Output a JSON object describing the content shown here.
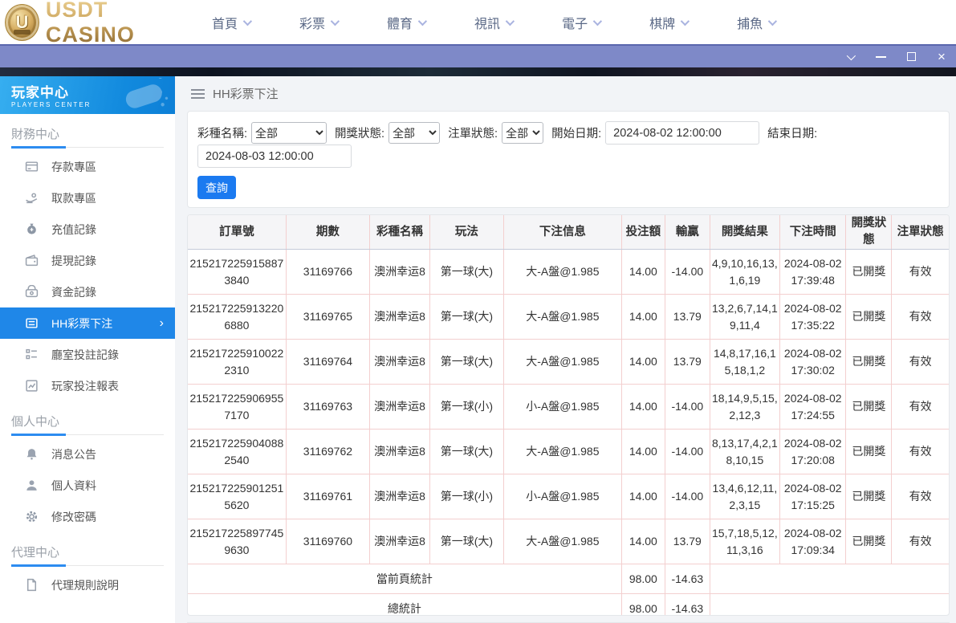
{
  "topnav": {
    "logo_text": "USDT CASINO",
    "logo_symbol": "U",
    "items": [
      {
        "label": "首頁"
      },
      {
        "label": "彩票"
      },
      {
        "label": "體育"
      },
      {
        "label": "視訊"
      },
      {
        "label": "電子"
      },
      {
        "label": "棋牌"
      },
      {
        "label": "捕魚"
      }
    ]
  },
  "titlebar": {
    "controls": [
      "chevron-down",
      "minimize",
      "maximize",
      "close"
    ],
    "close_glyph": "×"
  },
  "sidebar": {
    "header": {
      "title": "玩家中心",
      "subtitle": "PLAYERS CENTER"
    },
    "sections": [
      {
        "label": "財務中心"
      },
      {
        "label": "個人中心"
      },
      {
        "label": "代理中心"
      }
    ],
    "finance_items": [
      {
        "label": "存款專區"
      },
      {
        "label": "取款專區"
      },
      {
        "label": "充值記錄"
      },
      {
        "label": "提現記錄"
      },
      {
        "label": "資金記錄"
      },
      {
        "label": "HH彩票下注",
        "active": true,
        "arrow": "›"
      },
      {
        "label": "廳室投註記錄"
      },
      {
        "label": "玩家投注報表"
      }
    ],
    "personal_items": [
      {
        "label": "消息公告"
      },
      {
        "label": "個人資料"
      },
      {
        "label": "修改密碼"
      }
    ],
    "agent_items": [
      {
        "label": "代理規則說明"
      }
    ]
  },
  "main": {
    "page_title": "HH彩票下注",
    "filters": {
      "lottery_label": "彩種名稱:",
      "lottery_value": "全部",
      "draw_status_label": "開獎狀態:",
      "draw_status_value": "全部",
      "order_status_label": "注單狀態:",
      "order_status_value": "全部",
      "start_label": "開始日期:",
      "start_value": "2024-08-02 12:00:00",
      "end_label": "結束日期:",
      "end_value": "2024-08-03 12:00:00",
      "search_label": "查詢"
    },
    "table": {
      "headers": [
        "訂單號",
        "期數",
        "彩種名稱",
        "玩法",
        "下注信息",
        "投注額",
        "輸贏",
        "開獎結果",
        "下注時間",
        "開獎狀態",
        "注單狀態"
      ],
      "rows": [
        [
          "2152172259158873840",
          "31169766",
          "澳洲幸运8",
          "第一球(大)",
          "大-A盤@1.985",
          "14.00",
          "-14.00",
          "4,9,10,16,13,1,6,19",
          "2024-08-02 17:39:48",
          "已開獎",
          "有效"
        ],
        [
          "2152172259132206880",
          "31169765",
          "澳洲幸运8",
          "第一球(大)",
          "大-A盤@1.985",
          "14.00",
          "13.79",
          "13,2,6,7,14,19,11,4",
          "2024-08-02 17:35:22",
          "已開獎",
          "有效"
        ],
        [
          "2152172259100222310",
          "31169764",
          "澳洲幸运8",
          "第一球(大)",
          "大-A盤@1.985",
          "14.00",
          "13.79",
          "14,8,17,16,15,18,1,2",
          "2024-08-02 17:30:02",
          "已開獎",
          "有效"
        ],
        [
          "2152172259069557170",
          "31169763",
          "澳洲幸运8",
          "第一球(小)",
          "小-A盤@1.985",
          "14.00",
          "-14.00",
          "18,14,9,5,15,2,12,3",
          "2024-08-02 17:24:55",
          "已開獎",
          "有效"
        ],
        [
          "2152172259040882540",
          "31169762",
          "澳洲幸运8",
          "第一球(大)",
          "大-A盤@1.985",
          "14.00",
          "-14.00",
          "8,13,17,4,2,18,10,15",
          "2024-08-02 17:20:08",
          "已開獎",
          "有效"
        ],
        [
          "2152172259012515620",
          "31169761",
          "澳洲幸运8",
          "第一球(小)",
          "小-A盤@1.985",
          "14.00",
          "-14.00",
          "13,4,6,12,11,2,3,15",
          "2024-08-02 17:15:25",
          "已開獎",
          "有效"
        ],
        [
          "2152172258977459630",
          "31169760",
          "澳洲幸运8",
          "第一球(大)",
          "大-A盤@1.985",
          "14.00",
          "13.79",
          "15,7,18,5,12,11,3,16",
          "2024-08-02 17:09:34",
          "已開獎",
          "有效"
        ]
      ],
      "summary": [
        {
          "label": "當前頁統計",
          "bet_total": "98.00",
          "winloss_total": "-14.63"
        },
        {
          "label": "總統計",
          "bet_total": "98.00",
          "winloss_total": "-14.63"
        }
      ]
    }
  },
  "colors": {
    "accent_blue": "#1f87e8",
    "titlebar_blue": "#7e89c8",
    "sidebar_header_gradient": [
      "#36aef0",
      "#0d7fd6"
    ],
    "table_border_pink": "#f3cfcf",
    "logo_gold": "#cda75f",
    "nav_text": "#5a6886"
  }
}
